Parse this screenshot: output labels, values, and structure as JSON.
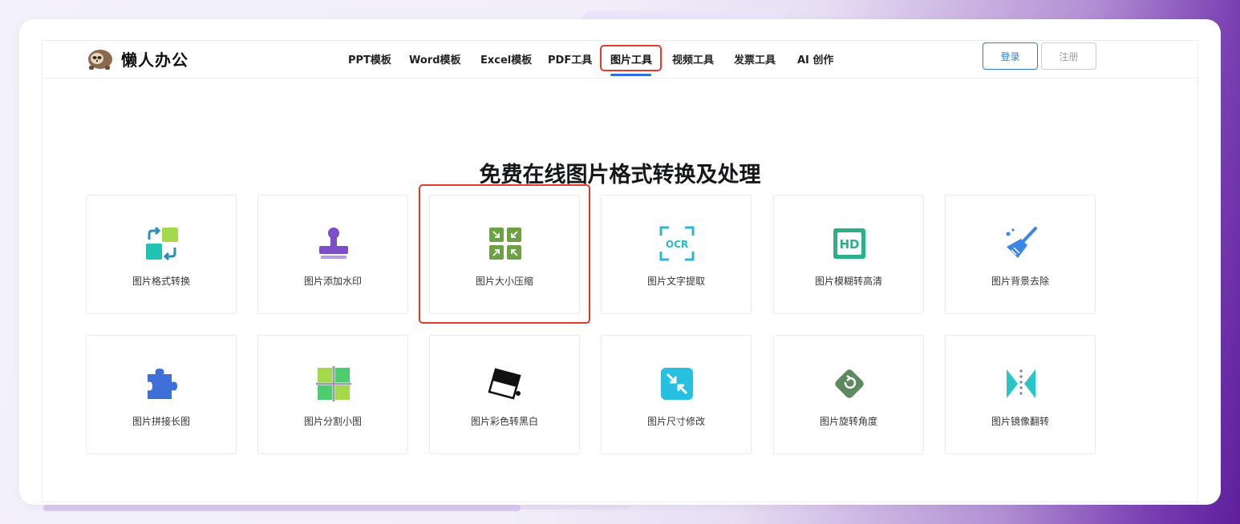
{
  "header": {
    "logo_text": "懒人办公",
    "nav": [
      {
        "label": "PPT模板"
      },
      {
        "label": "Word模板"
      },
      {
        "label": "Excel模板"
      },
      {
        "label": "PDF工具"
      },
      {
        "label": "图片工具",
        "active": true
      },
      {
        "label": "视频工具"
      },
      {
        "label": "发票工具"
      },
      {
        "label": "AI 创作"
      }
    ],
    "login_label": "登录",
    "register_label": "注册"
  },
  "main": {
    "title": "免费在线图片格式转换及处理",
    "tools": [
      {
        "label": "图片格式转换",
        "icon": "format-convert-icon"
      },
      {
        "label": "图片添加水印",
        "icon": "stamp-icon"
      },
      {
        "label": "图片大小压缩",
        "icon": "compress-icon",
        "highlighted": true
      },
      {
        "label": "图片文字提取",
        "icon": "ocr-icon"
      },
      {
        "label": "图片模糊转高清",
        "icon": "hd-icon"
      },
      {
        "label": "图片背景去除",
        "icon": "broom-icon"
      },
      {
        "label": "图片拼接长图",
        "icon": "puzzle-icon"
      },
      {
        "label": "图片分割小图",
        "icon": "grid-split-icon"
      },
      {
        "label": "图片彩色转黑白",
        "icon": "paint-bucket-icon"
      },
      {
        "label": "图片尺寸修改",
        "icon": "resize-icon"
      },
      {
        "label": "图片旋转角度",
        "icon": "rotate-icon"
      },
      {
        "label": "图片镜像翻转",
        "icon": "mirror-flip-icon"
      }
    ]
  },
  "colors": {
    "accent": "#2f6fde",
    "highlight": "#e53a2b"
  }
}
